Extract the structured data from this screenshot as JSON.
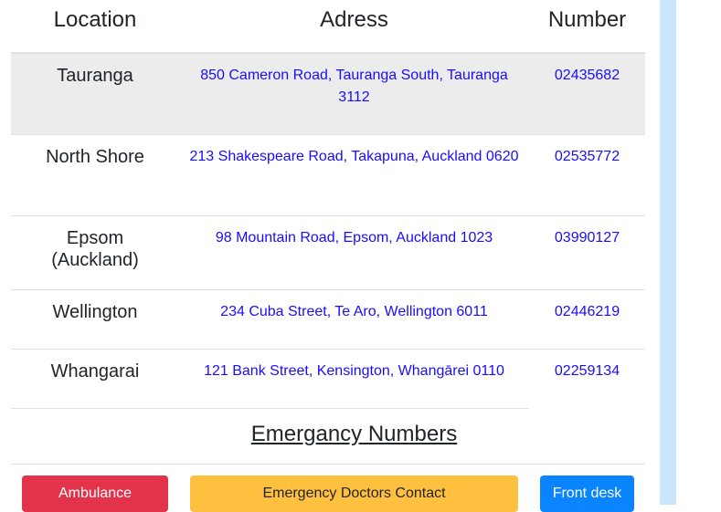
{
  "table": {
    "headers": [
      "Location",
      "Adress",
      "Number"
    ],
    "rows": [
      {
        "location": "Tauranga",
        "address": "850 Cameron Road, Tauranga South, Tauranga 3112",
        "number": "02435682"
      },
      {
        "location": "North Shore",
        "address": "213 Shakespeare Road, Takapuna, Auckland 0620",
        "number": "02535772"
      },
      {
        "location": "Epsom (Auckland)",
        "address": "98 Mountain Road, Epsom, Auckland 1023",
        "number": "03990127"
      },
      {
        "location": "Wellington",
        "address": "234 Cuba Street, Te Aro, Wellington 6011",
        "number": "02446219"
      },
      {
        "location": "Whangarai",
        "address": "121 Bank Street, Kensington, Whangārei 0110",
        "number": "02259134"
      }
    ]
  },
  "emergency": {
    "title": "Emergancy Numbers",
    "buttons": [
      "Ambulance",
      "Emergency Doctors Contact",
      "Front desk"
    ]
  },
  "colors": {
    "danger": "#e3334a",
    "warning": "#ffc040",
    "primary": "#0a84ff",
    "highlight": "#ececec",
    "strip": "#cce5ff"
  }
}
